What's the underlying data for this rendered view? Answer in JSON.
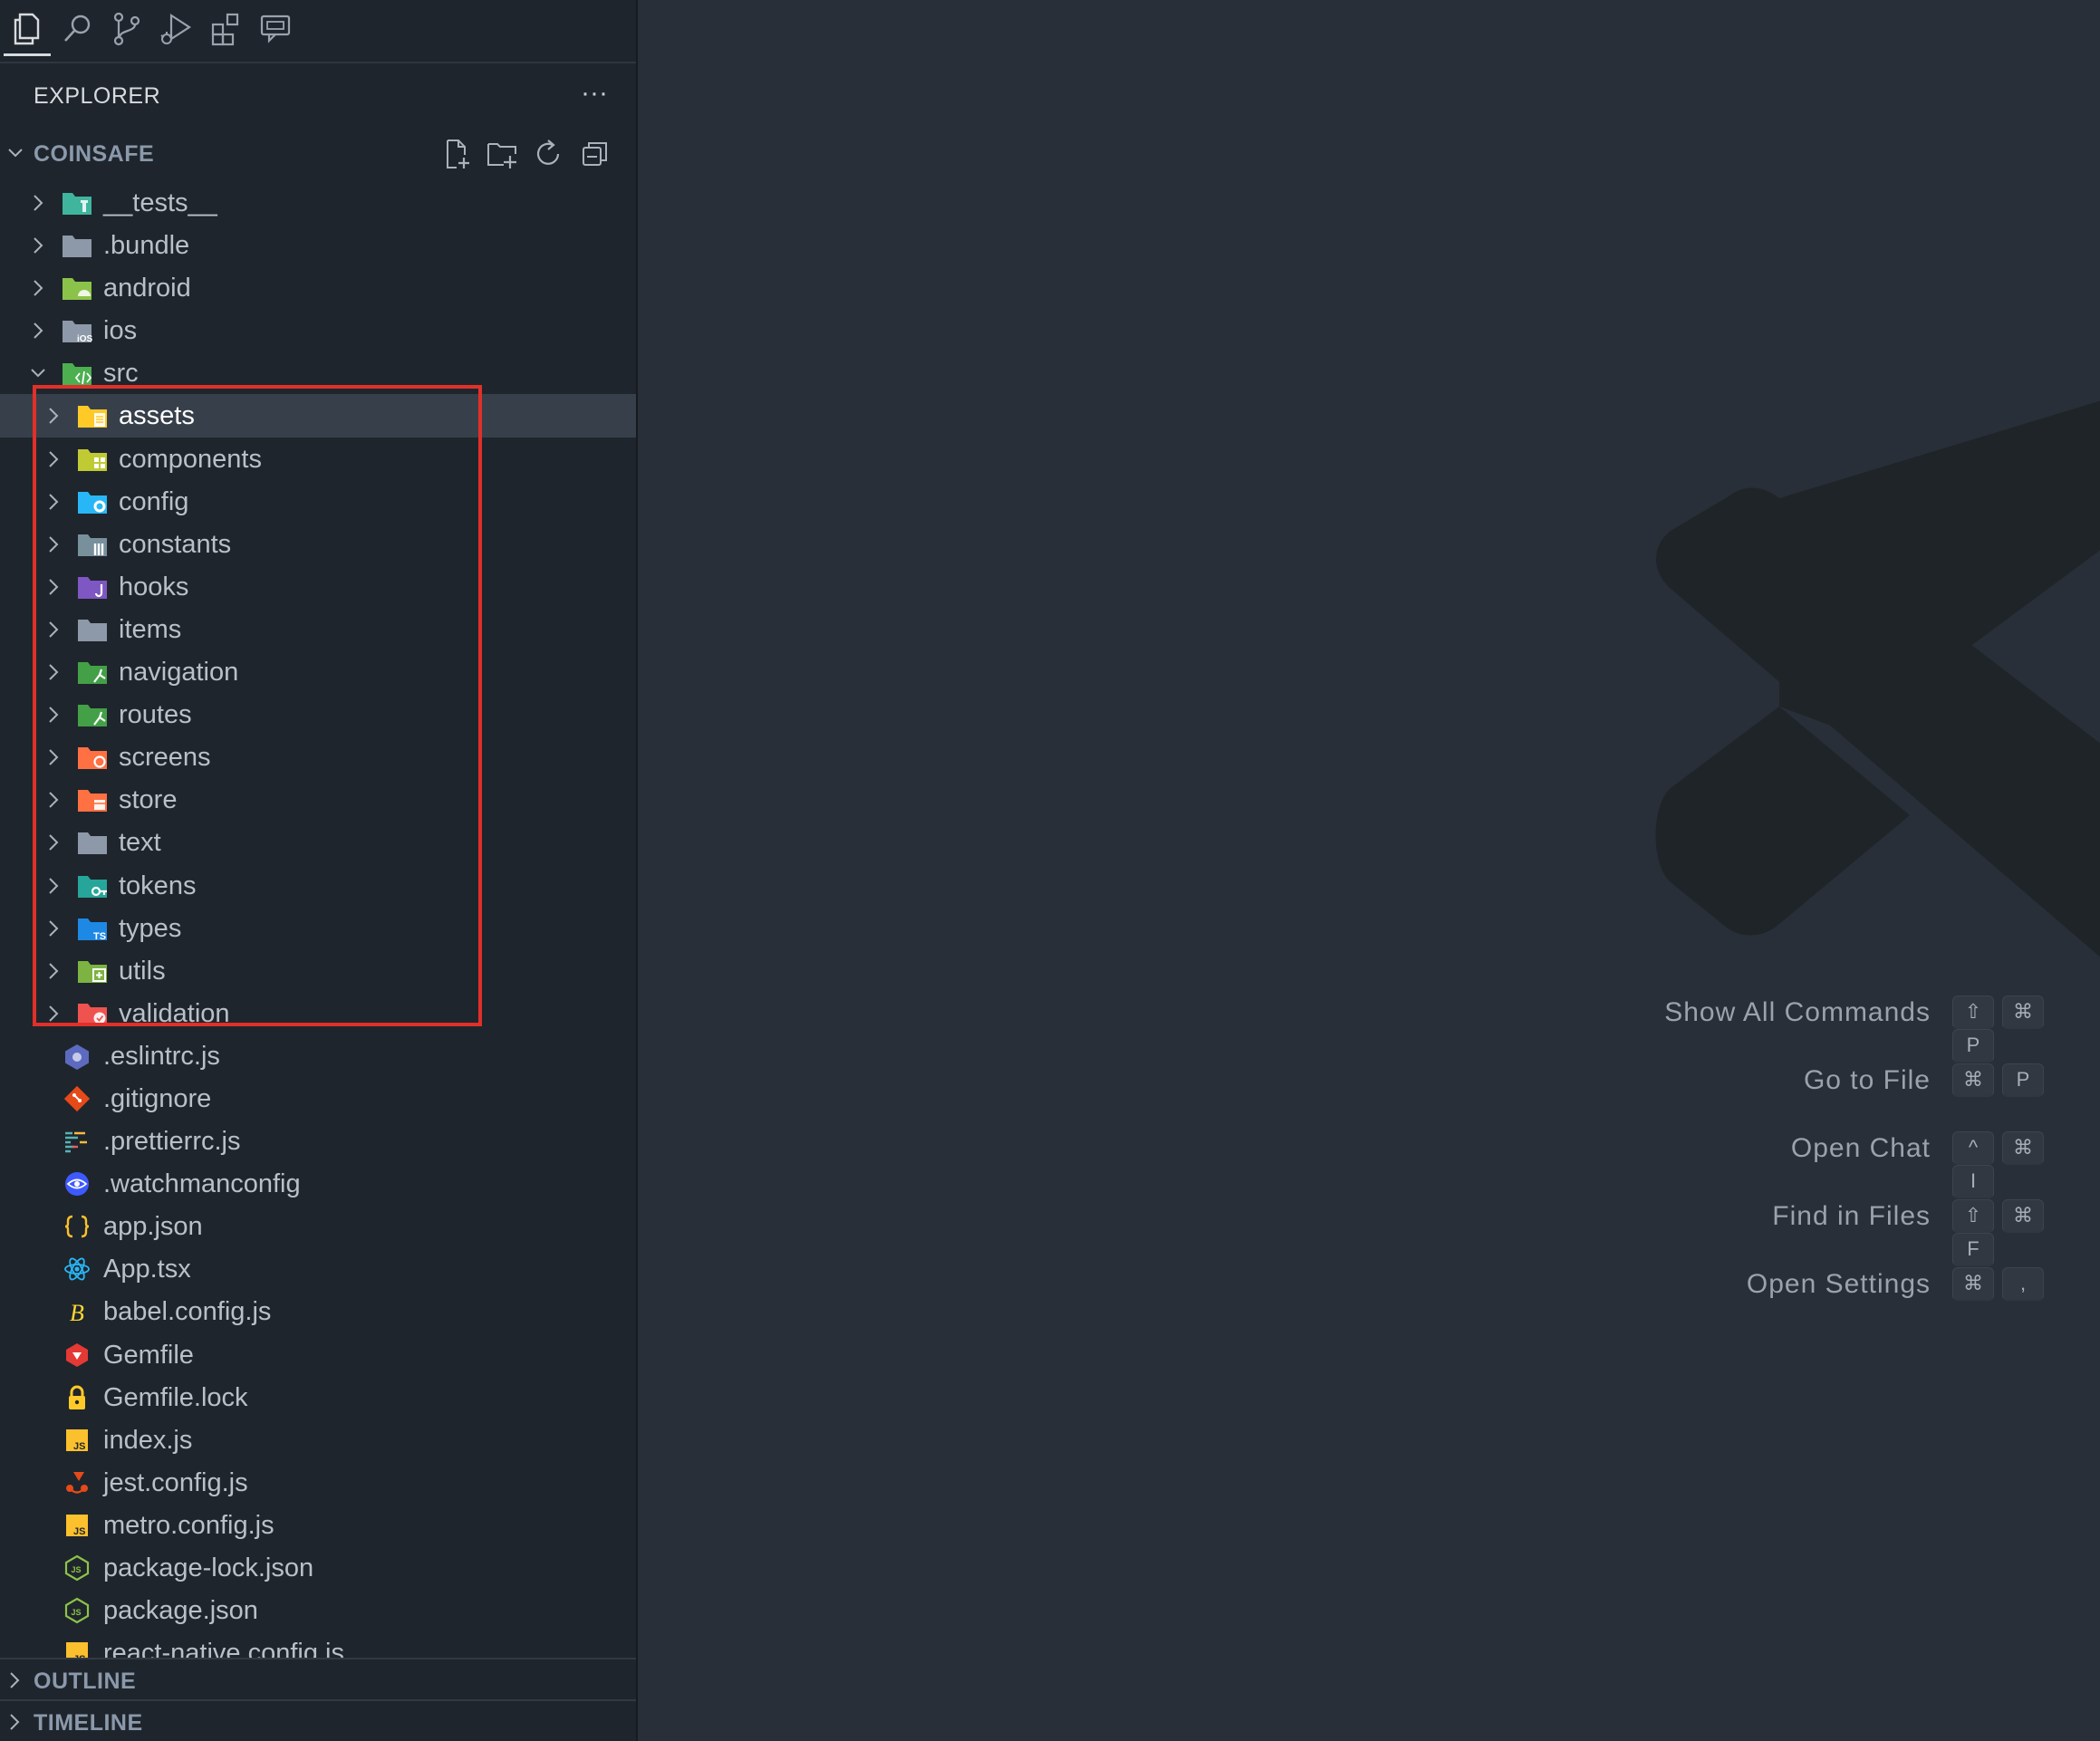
{
  "activity_bar": [
    {
      "name": "explorer-icon",
      "active": true
    },
    {
      "name": "search-icon",
      "active": false
    },
    {
      "name": "source-control-icon",
      "active": false
    },
    {
      "name": "run-debug-icon",
      "active": false
    },
    {
      "name": "extensions-icon",
      "active": false
    },
    {
      "name": "chat-icon",
      "active": false
    }
  ],
  "explorer": {
    "title": "EXPLORER",
    "more_label": "···",
    "root": {
      "label": "COINSAFE",
      "toolbar": [
        "new-file-icon",
        "new-folder-icon",
        "refresh-icon",
        "collapse-all-icon"
      ]
    },
    "tree": [
      {
        "label": "__tests__",
        "kind": "folder",
        "depth": 0,
        "expanded": false,
        "icon": "folder-test-icon",
        "color": "#3fb59e",
        "glyph": "test"
      },
      {
        "label": ".bundle",
        "kind": "folder",
        "depth": 0,
        "expanded": false,
        "icon": "folder-icon",
        "color": "#8d98a8",
        "glyph": ""
      },
      {
        "label": "android",
        "kind": "folder",
        "depth": 0,
        "expanded": false,
        "icon": "folder-android-icon",
        "color": "#8bc34a",
        "glyph": "android"
      },
      {
        "label": "ios",
        "kind": "folder",
        "depth": 0,
        "expanded": false,
        "icon": "folder-ios-icon",
        "color": "#8d98a8",
        "glyph": "ios"
      },
      {
        "label": "src",
        "kind": "folder",
        "depth": 0,
        "expanded": true,
        "icon": "folder-src-icon",
        "color": "#4caf50",
        "glyph": "code"
      },
      {
        "label": "assets",
        "kind": "folder",
        "depth": 1,
        "expanded": false,
        "selected": true,
        "icon": "folder-assets-icon",
        "color": "#ffca28",
        "glyph": "doc"
      },
      {
        "label": "components",
        "kind": "folder",
        "depth": 1,
        "expanded": false,
        "icon": "folder-components-icon",
        "color": "#c0ca33",
        "glyph": "grid"
      },
      {
        "label": "config",
        "kind": "folder",
        "depth": 1,
        "expanded": false,
        "icon": "folder-config-icon",
        "color": "#29b6f6",
        "glyph": "gear"
      },
      {
        "label": "constants",
        "kind": "folder",
        "depth": 1,
        "expanded": false,
        "icon": "folder-constants-icon",
        "color": "#78909c",
        "glyph": "bars"
      },
      {
        "label": "hooks",
        "kind": "folder",
        "depth": 1,
        "expanded": false,
        "icon": "folder-hooks-icon",
        "color": "#7e57c2",
        "glyph": "hook"
      },
      {
        "label": "items",
        "kind": "folder",
        "depth": 1,
        "expanded": false,
        "icon": "folder-icon",
        "color": "#8d98a8",
        "glyph": ""
      },
      {
        "label": "navigation",
        "kind": "folder",
        "depth": 1,
        "expanded": false,
        "icon": "folder-navigation-icon",
        "color": "#43a047",
        "glyph": "route"
      },
      {
        "label": "routes",
        "kind": "folder",
        "depth": 1,
        "expanded": false,
        "icon": "folder-routes-icon",
        "color": "#43a047",
        "glyph": "route"
      },
      {
        "label": "screens",
        "kind": "folder",
        "depth": 1,
        "expanded": false,
        "icon": "folder-screens-icon",
        "color": "#ff7043",
        "glyph": "dot"
      },
      {
        "label": "store",
        "kind": "folder",
        "depth": 1,
        "expanded": false,
        "icon": "folder-store-icon",
        "color": "#ff7043",
        "glyph": "store"
      },
      {
        "label": "text",
        "kind": "folder",
        "depth": 1,
        "expanded": false,
        "icon": "folder-icon",
        "color": "#8d98a8",
        "glyph": ""
      },
      {
        "label": "tokens",
        "kind": "folder",
        "depth": 1,
        "expanded": false,
        "icon": "folder-tokens-icon",
        "color": "#26a69a",
        "glyph": "key"
      },
      {
        "label": "types",
        "kind": "folder",
        "depth": 1,
        "expanded": false,
        "icon": "folder-types-icon",
        "color": "#1e88e5",
        "glyph": "TS"
      },
      {
        "label": "utils",
        "kind": "folder",
        "depth": 1,
        "expanded": false,
        "icon": "folder-utils-icon",
        "color": "#7cb342",
        "glyph": "plus"
      },
      {
        "label": "validation",
        "kind": "folder",
        "depth": 1,
        "expanded": false,
        "icon": "folder-validation-icon",
        "color": "#ef5350",
        "glyph": "check"
      },
      {
        "label": ".eslintrc.js",
        "kind": "file",
        "depth": 0,
        "icon": "eslint-icon",
        "color": "#5c6bc0",
        "glyph": "eslint"
      },
      {
        "label": ".gitignore",
        "kind": "file",
        "depth": 0,
        "icon": "git-icon",
        "color": "#e64a19",
        "glyph": "git"
      },
      {
        "label": ".prettierrc.js",
        "kind": "file",
        "depth": 0,
        "icon": "prettier-icon",
        "color": "#56b3b4",
        "glyph": "prettier"
      },
      {
        "label": ".watchmanconfig",
        "kind": "file",
        "depth": 0,
        "icon": "watchman-icon",
        "color": "#3d5afe",
        "glyph": "eye"
      },
      {
        "label": "app.json",
        "kind": "file",
        "depth": 0,
        "icon": "json-icon",
        "color": "#fbc02d",
        "glyph": "braces"
      },
      {
        "label": "App.tsx",
        "kind": "file",
        "depth": 0,
        "icon": "react-icon",
        "color": "#29b6f6",
        "glyph": "react"
      },
      {
        "label": "babel.config.js",
        "kind": "file",
        "depth": 0,
        "icon": "babel-icon",
        "color": "#fdd835",
        "glyph": "B"
      },
      {
        "label": "Gemfile",
        "kind": "file",
        "depth": 0,
        "icon": "ruby-gem-icon",
        "color": "#e53935",
        "glyph": "gem"
      },
      {
        "label": "Gemfile.lock",
        "kind": "file",
        "depth": 0,
        "icon": "lock-icon",
        "color": "#ffca28",
        "glyph": "lock"
      },
      {
        "label": "index.js",
        "kind": "file",
        "depth": 0,
        "icon": "javascript-icon",
        "color": "#fbc02d",
        "glyph": "JS"
      },
      {
        "label": "jest.config.js",
        "kind": "file",
        "depth": 0,
        "icon": "jest-icon",
        "color": "#e64a19",
        "glyph": "jest"
      },
      {
        "label": "metro.config.js",
        "kind": "file",
        "depth": 0,
        "icon": "javascript-icon",
        "color": "#fbc02d",
        "glyph": "JS"
      },
      {
        "label": "package-lock.json",
        "kind": "file",
        "depth": 0,
        "icon": "nodejs-icon",
        "color": "#8bc34a",
        "glyph": "node"
      },
      {
        "label": "package.json",
        "kind": "file",
        "depth": 0,
        "icon": "nodejs-icon",
        "color": "#8bc34a",
        "glyph": "node"
      },
      {
        "label": "react-native.config.js",
        "kind": "file",
        "depth": 0,
        "icon": "javascript-icon",
        "color": "#fbc02d",
        "glyph": "JS"
      }
    ]
  },
  "panels": {
    "outline": "OUTLINE",
    "timeline": "TIMELINE"
  },
  "editor": {
    "watermark": "vscode-logo-icon",
    "commands": [
      {
        "label": "Show All Commands",
        "keys": [
          "⇧",
          "⌘",
          "P"
        ]
      },
      {
        "label": "Go to File",
        "keys": [
          "⌘",
          "P"
        ]
      },
      {
        "label": "Open Chat",
        "keys": [
          "^",
          "⌘",
          "I"
        ]
      },
      {
        "label": "Find in Files",
        "keys": [
          "⇧",
          "⌘",
          "F"
        ]
      },
      {
        "label": "Open Settings",
        "keys": [
          "⌘",
          ","
        ]
      }
    ]
  },
  "theme": {
    "sidebar_bg": "#1f252c",
    "editor_bg": "#282f38",
    "selection_bg": "#37404a",
    "highlight_border": "#e0302a"
  }
}
